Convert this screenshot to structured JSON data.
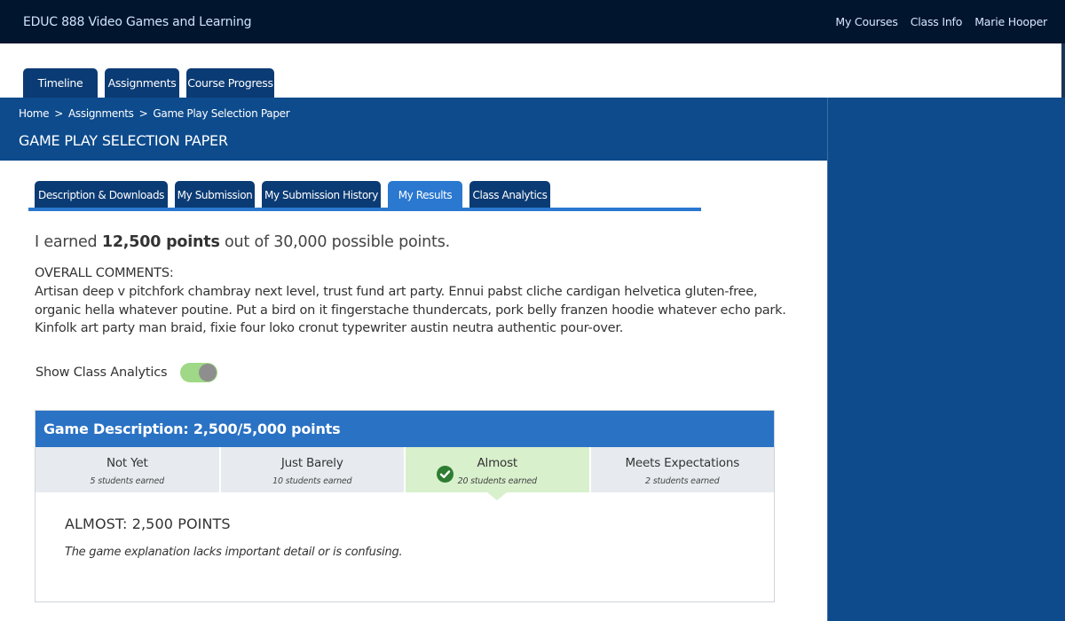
{
  "app_title": "EDUC 888 Video Games and Learning",
  "top_nav": {
    "my_courses": "My Courses",
    "class_info": "Class Info",
    "user_name": "Marie Hooper"
  },
  "main_tabs": [
    {
      "label": "Timeline"
    },
    {
      "label": "Assignments"
    },
    {
      "label": "Course Progress"
    }
  ],
  "breadcrumb": {
    "items": [
      "Home",
      "Assignments",
      "Game Play Selection Paper"
    ],
    "separator": ">"
  },
  "page_title": "GAME PLAY SELECTION PAPER",
  "sub_tabs": [
    {
      "label": "Description & Downloads"
    },
    {
      "label": "My Submission"
    },
    {
      "label": "My Submission History"
    },
    {
      "label": "My Results",
      "active": true
    },
    {
      "label": "Class Analytics"
    }
  ],
  "earned": {
    "prefix": "I earned ",
    "points": "12,500 points",
    "suffix": " out of 30,000 possible points."
  },
  "comments": {
    "heading": "OVERALL COMMENTS:",
    "text": "Artisan deep v pitchfork chambray next level, trust fund art party. Ennui pabst cliche cardigan helvetica gluten-free, organic hella whatever poutine. Put a bird on it fingerstache thundercats, pork belly franzen hoodie whatever echo park. Kinfolk art party man braid, fixie four loko cronut typewriter austin neutra authentic pour-over."
  },
  "analytics_toggle": {
    "label": "Show Class Analytics",
    "on": true
  },
  "rubric": {
    "header": "Game Description: 2,500/5,000 points",
    "levels": [
      {
        "name": "Not Yet",
        "count": "5 students earned"
      },
      {
        "name": "Just Barely",
        "count": "10 students earned"
      },
      {
        "name": "Almost",
        "count": "20 students earned",
        "selected": true
      },
      {
        "name": "Meets Expectations",
        "count": "2 students earned"
      }
    ],
    "result_title": "ALMOST: 2,500 POINTS",
    "result_description": "The game explanation lacks important detail or is confusing."
  },
  "colors": {
    "topbar": "#02152e",
    "brand_blue": "#0d4b8c",
    "tab_dark": "#0b3b74",
    "tab_active": "#2a78d0",
    "rubric_header": "#2a72c4",
    "selected_level": "#d8f0cc",
    "toggle_on": "#9fd886",
    "check_green": "#2e7d32"
  },
  "icons": {
    "selected_level": "check-circle-icon",
    "toggle": "toggle-switch"
  }
}
